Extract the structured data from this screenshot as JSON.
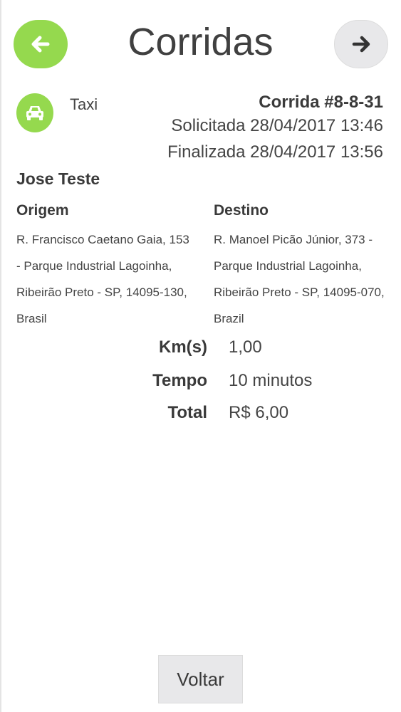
{
  "header": {
    "title": "Corridas",
    "back_icon": "arrow-left-icon",
    "forward_icon": "arrow-right-icon"
  },
  "ride": {
    "service_icon": "taxi-icon",
    "service": "Taxi",
    "id_label": "Corrida #8-8-31",
    "requested": "Solicitada 28/04/2017 13:46",
    "finished": "Finalizada 28/04/2017 13:56",
    "passenger": "Jose Teste"
  },
  "origin": {
    "title": "Origem",
    "lines": [
      "R. Francisco Caetano Gaia, 153",
      "- Parque Industrial Lagoinha,",
      "Ribeirão Preto - SP, 14095-130,",
      "Brasil"
    ]
  },
  "destination": {
    "title": "Destino",
    "lines": [
      "R. Manoel Picão Júnior, 373 -",
      "Parque Industrial Lagoinha,",
      "Ribeirão Preto - SP, 14095-070,",
      "Brazil"
    ]
  },
  "stats": [
    {
      "label": "Km(s)",
      "value": "1,00"
    },
    {
      "label": "Tempo",
      "value": "10 minutos"
    },
    {
      "label": "Total",
      "value": "R$ 6,00"
    }
  ],
  "footer": {
    "back_label": "Voltar"
  },
  "colors": {
    "accent": "#95d94e",
    "button_gray": "#e8e8ea",
    "text": "#3a3a3a"
  }
}
